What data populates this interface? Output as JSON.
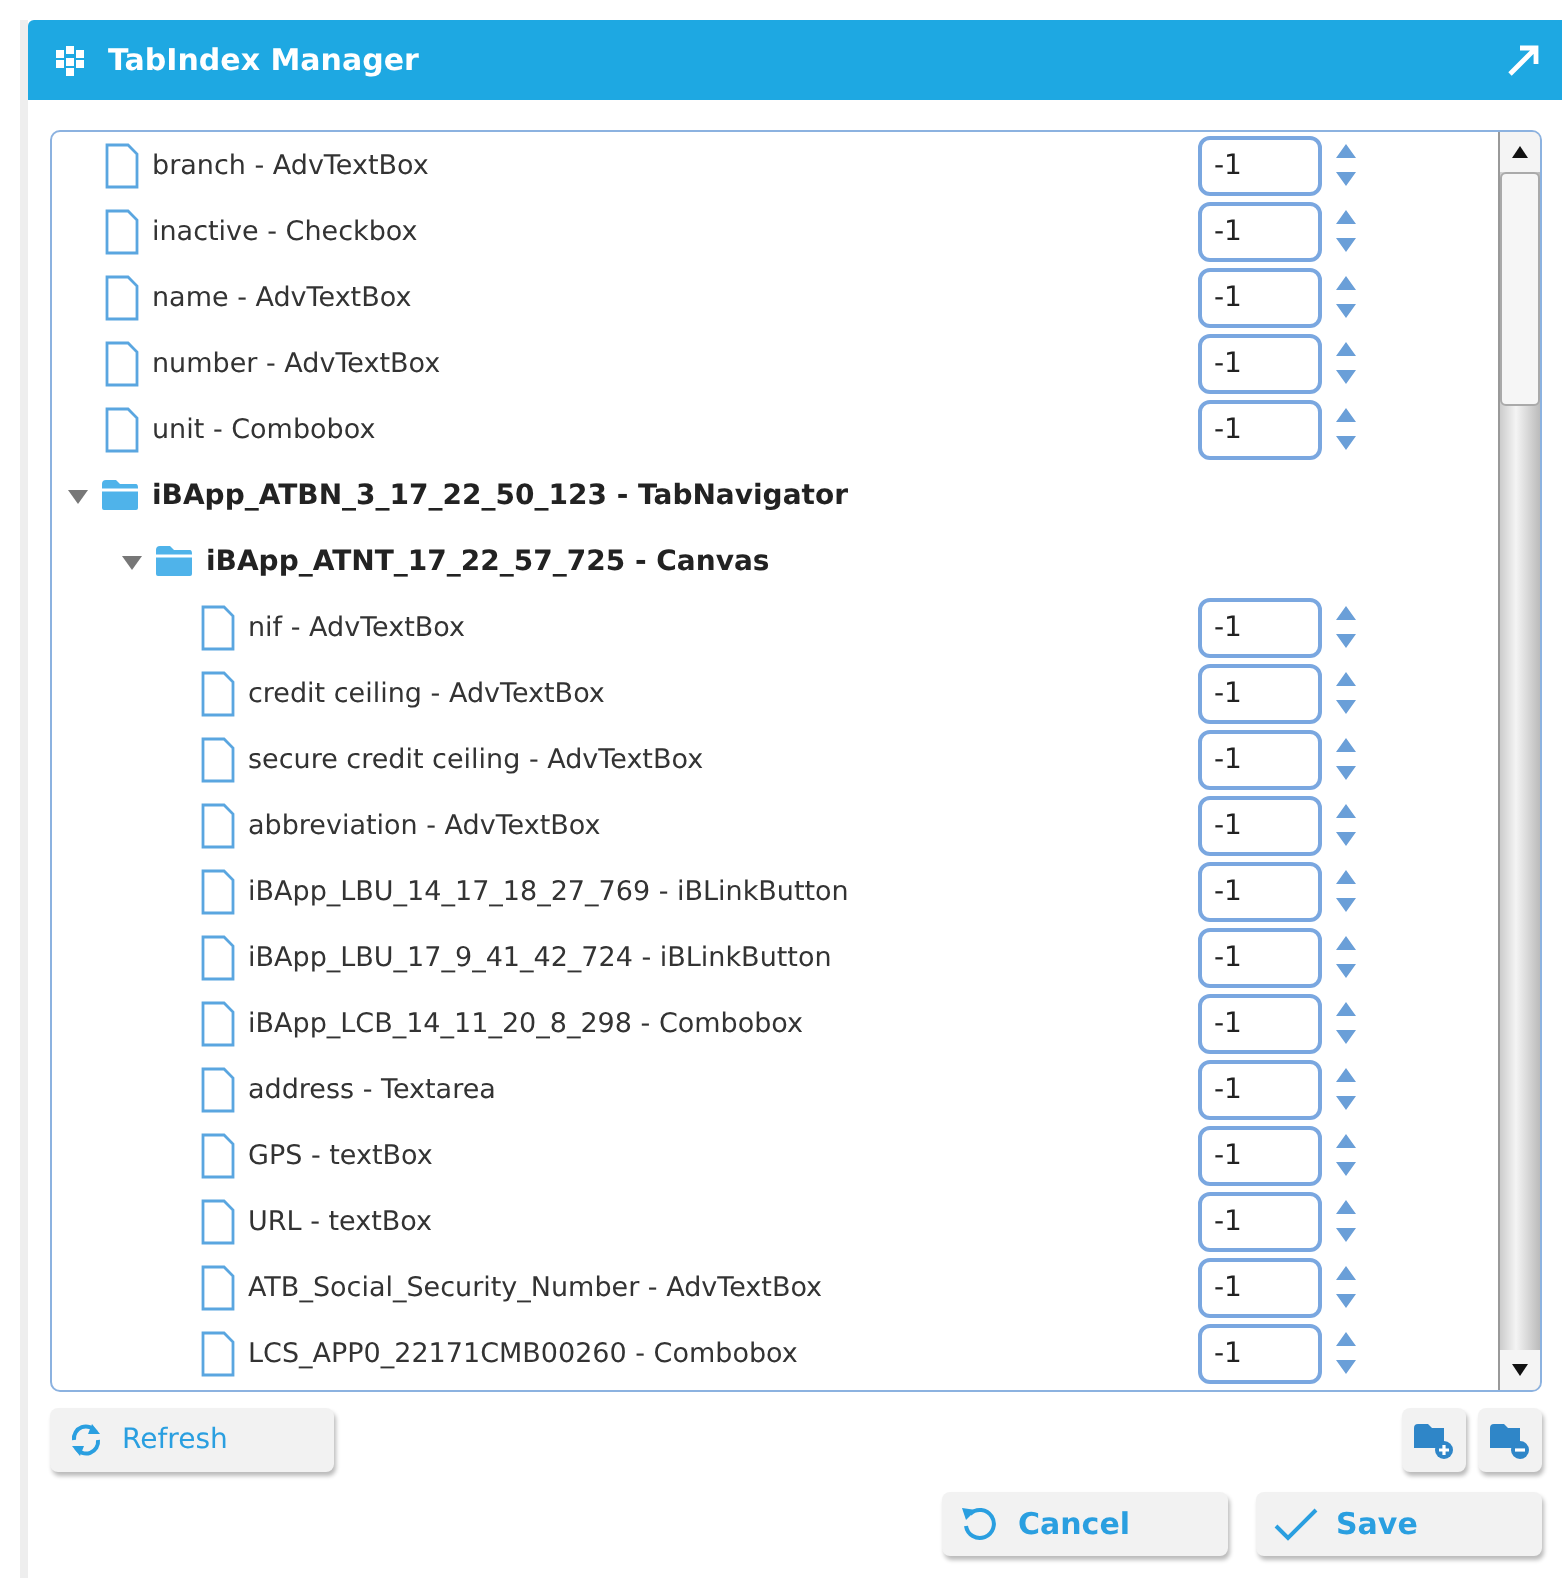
{
  "window": {
    "title": "TabIndex Manager"
  },
  "tree": {
    "items": [
      {
        "kind": "field",
        "label": "branch - AdvTextBox",
        "value": "-1"
      },
      {
        "kind": "field",
        "label": "inactive - Checkbox",
        "value": "-1"
      },
      {
        "kind": "field",
        "label": "name - AdvTextBox",
        "value": "-1"
      },
      {
        "kind": "field",
        "label": "number - AdvTextBox",
        "value": "-1"
      },
      {
        "kind": "field",
        "label": "unit - Combobox",
        "value": "-1"
      },
      {
        "kind": "folder",
        "label": "iBApp_ATBN_3_17_22_50_123 - TabNavigator",
        "expanded": true,
        "children": [
          {
            "kind": "folder",
            "label": "iBApp_ATNT_17_22_57_725 - Canvas",
            "expanded": true,
            "children": [
              {
                "kind": "field",
                "label": "nif - AdvTextBox",
                "value": "-1"
              },
              {
                "kind": "field",
                "label": "credit ceiling - AdvTextBox",
                "value": "-1"
              },
              {
                "kind": "field",
                "label": "secure credit ceiling - AdvTextBox",
                "value": "-1"
              },
              {
                "kind": "field",
                "label": "abbreviation - AdvTextBox",
                "value": "-1"
              },
              {
                "kind": "field",
                "label": "iBApp_LBU_14_17_18_27_769 - iBLinkButton",
                "value": "-1"
              },
              {
                "kind": "field",
                "label": "iBApp_LBU_17_9_41_42_724 - iBLinkButton",
                "value": "-1"
              },
              {
                "kind": "field",
                "label": "iBApp_LCB_14_11_20_8_298 - Combobox",
                "value": "-1"
              },
              {
                "kind": "field",
                "label": "address - Textarea",
                "value": "-1"
              },
              {
                "kind": "field",
                "label": "GPS - textBox",
                "value": "-1"
              },
              {
                "kind": "field",
                "label": "URL - textBox",
                "value": "-1"
              },
              {
                "kind": "field",
                "label": "ATB_Social_Security_Number - AdvTextBox",
                "value": "-1"
              },
              {
                "kind": "field",
                "label": "LCS_APP0_22171CMB00260 - Combobox",
                "value": "-1"
              }
            ]
          }
        ]
      }
    ]
  },
  "buttons": {
    "refresh": "Refresh",
    "cancel": "Cancel",
    "save": "Save"
  }
}
